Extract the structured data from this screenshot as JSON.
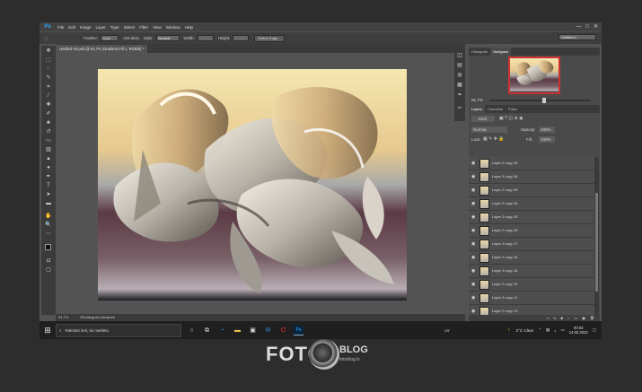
{
  "window": {
    "app_logo": "Ps",
    "menus": [
      "File",
      "Edit",
      "Image",
      "Layer",
      "Type",
      "Select",
      "Filter",
      "View",
      "Window",
      "Help"
    ],
    "controls": [
      "—",
      "□",
      "✕"
    ]
  },
  "options": {
    "feather_label": "Feather:",
    "feather_value": "0 px",
    "anti_alias": "Anti-alias",
    "style_label": "Style:",
    "style_value": "Normal",
    "width_label": "Width:",
    "height_label": "Height:",
    "refine_button": "Refine Edge...",
    "workspace": "Untitled-1"
  },
  "document": {
    "tab_title": "Untitled-16.psd @ 91,7% (Gradient Fill 1, RGB/8) *"
  },
  "status": {
    "zoom": "91,7%",
    "info": "Rectangular Marquee"
  },
  "panels": {
    "top_tabs": [
      "Histogram",
      "Navigator"
    ],
    "nav_zoom": "91,7%",
    "layer_tabs": [
      "Layers",
      "Channels",
      "Paths"
    ],
    "kind_label": "Kind",
    "blend_mode": "Normal",
    "opacity_label": "Opacity:",
    "opacity_value": "100%",
    "lock_label": "Lock:",
    "fill_label": "Fill:",
    "fill_value": "100%"
  },
  "layers": [
    "Layer 2 copy 36",
    "Layer 3 copy 36",
    "Layer 2 copy 35",
    "Layer 2 copy 34",
    "Layer 3 copy 25",
    "Layer 2 copy 28",
    "Layer 3 copy 17",
    "Layer 2 copy 18",
    "Layer 3 copy 18",
    "Layer 2 copy 19",
    "Layer 3 copy 11",
    "Layer 2 copy 13",
    "Layer 2 copy 12"
  ],
  "taskbar": {
    "search_placeholder": "Rakstiet šeit, lai meklētu",
    "lang": "LV",
    "weather": "2°C  Clear",
    "time": "00:03",
    "date": "14.02.2022"
  },
  "brand": {
    "foto": "FOTO",
    "blog": "BLOG",
    "url": "fotoblog.lv"
  },
  "colors": {
    "accent": "#31a8ff",
    "nav_border": "#cc3333"
  }
}
